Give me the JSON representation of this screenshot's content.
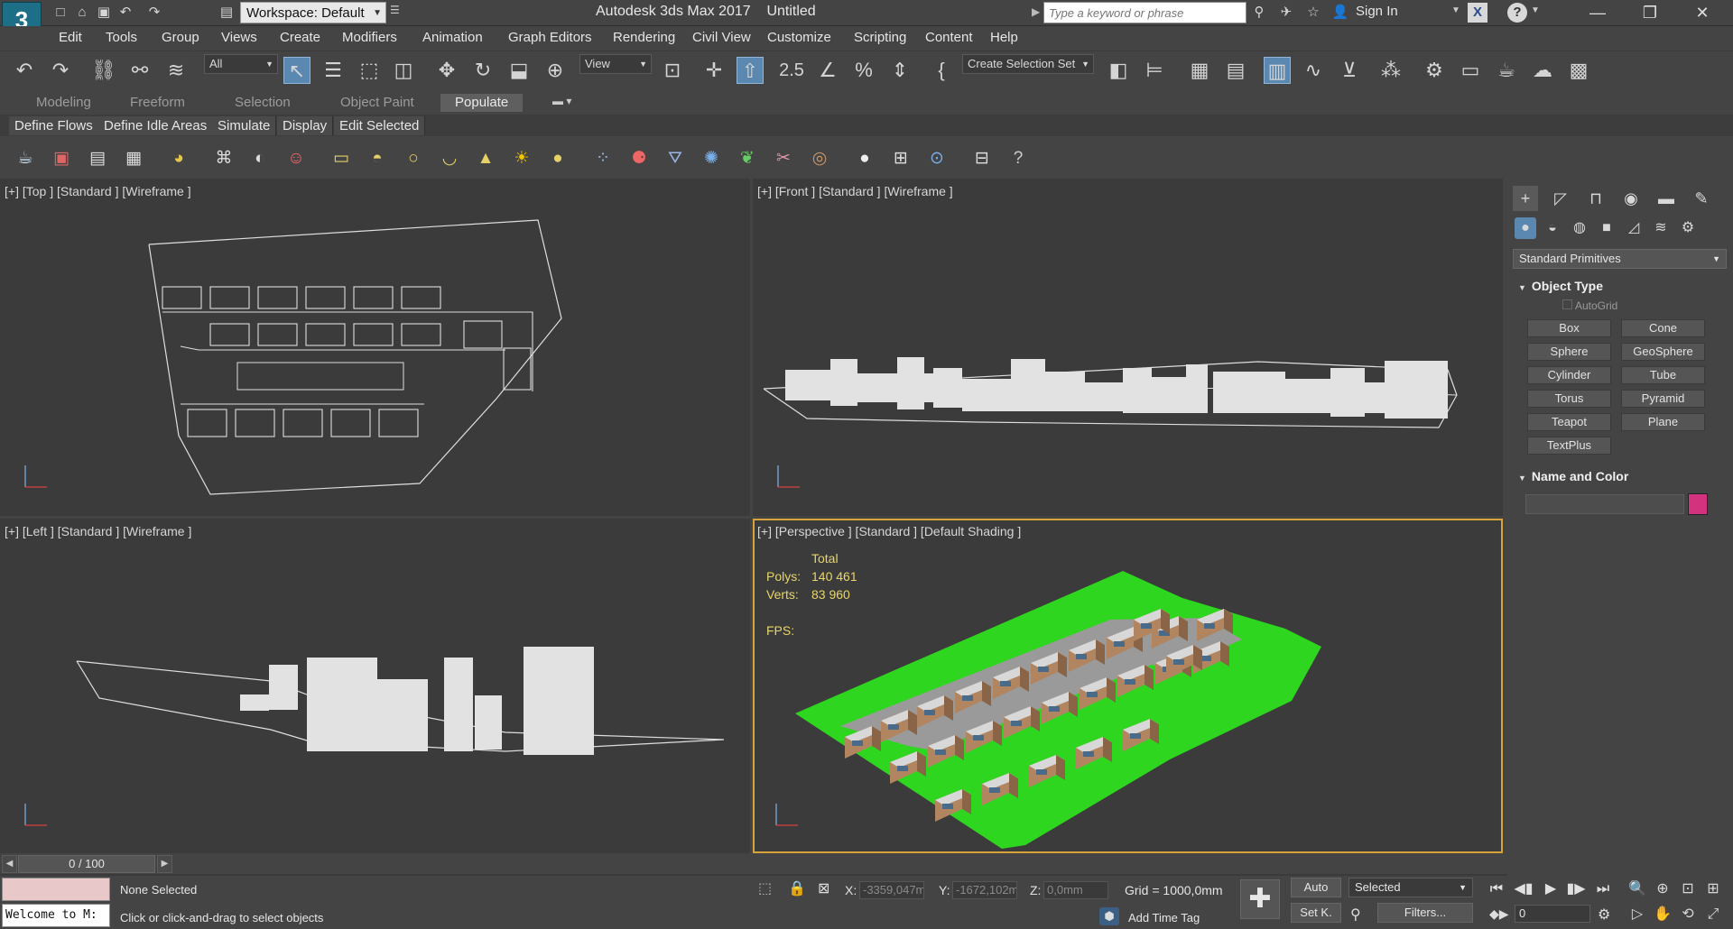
{
  "app": {
    "title": "Autodesk 3ds Max 2017",
    "document": "Untitled"
  },
  "workspace": {
    "label": "Workspace: Default"
  },
  "search": {
    "placeholder": "Type a keyword or phrase"
  },
  "account": {
    "signin": "Sign In"
  },
  "menus": [
    "Edit",
    "Tools",
    "Group",
    "Views",
    "Create",
    "Modifiers",
    "Animation",
    "Graph Editors",
    "Rendering",
    "Civil View",
    "Customize",
    "Scripting",
    "Content",
    "Help"
  ],
  "toolbar": {
    "filter": "All",
    "refcoord": "View",
    "selset": "Create Selection Set",
    "snap_label": "2.5"
  },
  "ribbon": {
    "tabs": [
      "Modeling",
      "Freeform",
      "Selection",
      "Object Paint",
      "Populate"
    ],
    "active": "Populate"
  },
  "populate": {
    "buttons": [
      "Define Flows",
      "Define Idle Areas",
      "Simulate",
      "Display",
      "Edit Selected"
    ]
  },
  "viewports": {
    "top": {
      "label": "[+] [Top ] [Standard ] [Wireframe ]"
    },
    "front": {
      "label": "[+] [Front ] [Standard ] [Wireframe ]"
    },
    "left": {
      "label": "[+] [Left ] [Standard ] [Wireframe ]"
    },
    "perspective": {
      "label": "[+] [Perspective ] [Standard ] [Default Shading ]"
    }
  },
  "stats": {
    "total_label": "Total",
    "polys_label": "Polys:",
    "polys": "140 461",
    "verts_label": "Verts:",
    "verts": "83 960",
    "fps_label": "FPS:"
  },
  "command_panel": {
    "category": "Standard Primitives",
    "object_type_title": "Object Type",
    "autogrid": "AutoGrid",
    "primitives": [
      "Box",
      "Cone",
      "Sphere",
      "GeoSphere",
      "Cylinder",
      "Tube",
      "Torus",
      "Pyramid",
      "Teapot",
      "Plane",
      "TextPlus"
    ],
    "name_color_title": "Name and Color",
    "object_color": "#d2327e"
  },
  "timeline": {
    "position": "0 / 100"
  },
  "status": {
    "selection": "None Selected",
    "prompt": "Click or click-and-drag to select objects",
    "maxscript": "Welcome to M:",
    "x_label": "X:",
    "x": "-3359,047m",
    "y_label": "Y:",
    "y": "-1672,102m",
    "z_label": "Z:",
    "z": "0,0mm",
    "grid": "Grid = 1000,0mm",
    "add_time_tag": "Add Time Tag"
  },
  "anim": {
    "auto": "Auto",
    "setkey": "Set K.",
    "key_filter": "Selected",
    "filters": "Filters...",
    "frame": "0"
  },
  "colors": {
    "ground": "#2fd61f",
    "building": "#b08560",
    "ui_bg": "#444444",
    "viewport_bg": "#3b3b3b",
    "active_border": "#d6a43a"
  }
}
